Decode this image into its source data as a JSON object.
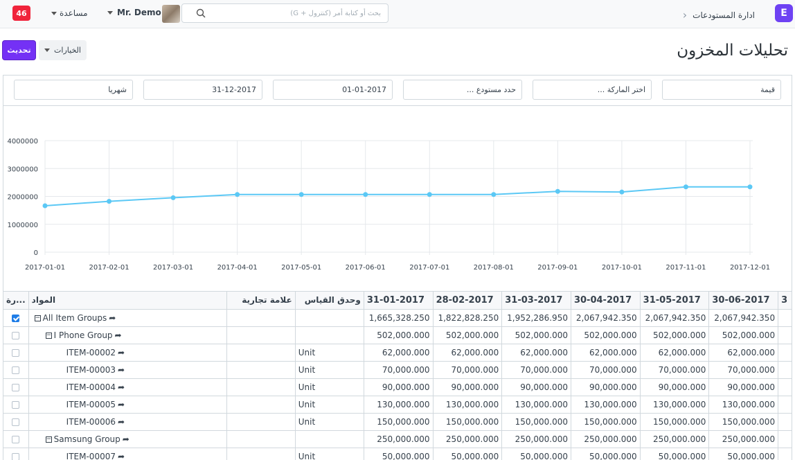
{
  "navbar": {
    "badge": "46",
    "help": "مساعدة",
    "user": "Mr. Demo",
    "search_placeholder": "بحث أو كتابة أمر (كنترول + G)",
    "breadcrumb": "ادارة المستودعات",
    "app_letter": "E"
  },
  "page": {
    "title": "تحليلات المخزون",
    "refresh_label": "تحديث",
    "options_label": "الخيارات"
  },
  "filters": {
    "value_type": "قيمة",
    "brand": "اختر الماركة ...",
    "warehouse": "حدد مستودع ...",
    "from_date": "01-01-2017",
    "to_date": "31-12-2017",
    "range": "شهريا"
  },
  "chart_data": {
    "type": "line",
    "x": [
      "2017-01-01",
      "2017-02-01",
      "2017-03-01",
      "2017-04-01",
      "2017-05-01",
      "2017-06-01",
      "2017-07-01",
      "2017-08-01",
      "2017-09-01",
      "2017-10-01",
      "2017-11-01",
      "2017-12-01"
    ],
    "series": [
      {
        "values": [
          1665328.25,
          1822828.25,
          1952286.95,
          2067942.35,
          2067942.35,
          2067942.35,
          2067942.35,
          2067942.35,
          2181000,
          2157000,
          2341000,
          2341000
        ]
      }
    ],
    "y_ticks": [
      "0",
      "1000000",
      "2000000",
      "3000000",
      "4000000"
    ],
    "ylim": [
      0,
      4000000
    ],
    "grid": true,
    "color": "#5bc8f5"
  },
  "table": {
    "headers": {
      "select": "...رة",
      "item": "المواد",
      "brand": "علامة تجارية",
      "uom": "وحدق القياس",
      "months": [
        "31-01-2017",
        "28-02-2017",
        "31-03-2017",
        "30-04-2017",
        "31-05-2017",
        "30-06-2017",
        "3"
      ]
    },
    "rows": [
      {
        "checked": true,
        "level": 0,
        "toggle": "−",
        "name": "All Item Groups",
        "uom": "",
        "values": [
          "1,665,328.250",
          "1,822,828.250",
          "1,952,286.950",
          "2,067,942.350",
          "2,067,942.350",
          "2,067,942.350"
        ]
      },
      {
        "checked": false,
        "level": 1,
        "toggle": "−",
        "name": "I Phone Group",
        "uom": "",
        "values": [
          "502,000.000",
          "502,000.000",
          "502,000.000",
          "502,000.000",
          "502,000.000",
          "502,000.000"
        ]
      },
      {
        "checked": false,
        "level": 2,
        "toggle": "",
        "name": "ITEM-00002",
        "uom": "Unit",
        "values": [
          "62,000.000",
          "62,000.000",
          "62,000.000",
          "62,000.000",
          "62,000.000",
          "62,000.000"
        ]
      },
      {
        "checked": false,
        "level": 2,
        "toggle": "",
        "name": "ITEM-00003",
        "uom": "Unit",
        "values": [
          "70,000.000",
          "70,000.000",
          "70,000.000",
          "70,000.000",
          "70,000.000",
          "70,000.000"
        ]
      },
      {
        "checked": false,
        "level": 2,
        "toggle": "",
        "name": "ITEM-00004",
        "uom": "Unit",
        "values": [
          "90,000.000",
          "90,000.000",
          "90,000.000",
          "90,000.000",
          "90,000.000",
          "90,000.000"
        ]
      },
      {
        "checked": false,
        "level": 2,
        "toggle": "",
        "name": "ITEM-00005",
        "uom": "Unit",
        "values": [
          "130,000.000",
          "130,000.000",
          "130,000.000",
          "130,000.000",
          "130,000.000",
          "130,000.000"
        ]
      },
      {
        "checked": false,
        "level": 2,
        "toggle": "",
        "name": "ITEM-00006",
        "uom": "Unit",
        "values": [
          "150,000.000",
          "150,000.000",
          "150,000.000",
          "150,000.000",
          "150,000.000",
          "150,000.000"
        ]
      },
      {
        "checked": false,
        "level": 1,
        "toggle": "−",
        "name": "Samsung Group",
        "uom": "",
        "values": [
          "250,000.000",
          "250,000.000",
          "250,000.000",
          "250,000.000",
          "250,000.000",
          "250,000.000"
        ]
      },
      {
        "checked": false,
        "level": 2,
        "toggle": "",
        "name": "ITEM-00007",
        "uom": "Unit",
        "values": [
          "50,000.000",
          "50,000.000",
          "50,000.000",
          "50,000.000",
          "50,000.000",
          "50,000.000"
        ]
      }
    ]
  }
}
